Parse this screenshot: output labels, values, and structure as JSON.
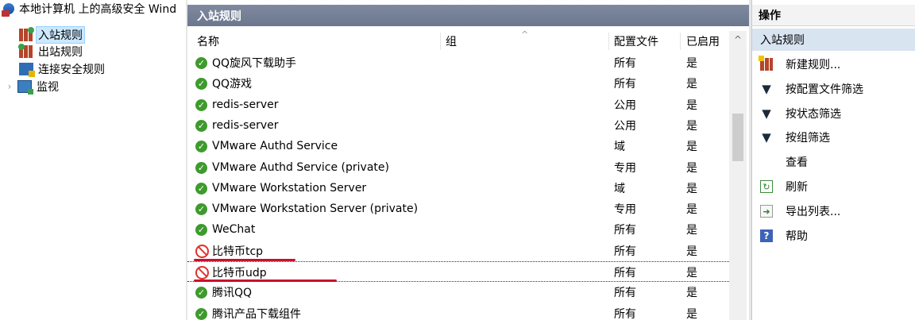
{
  "tree": {
    "root": "本地计算机 上的高级安全 Wind",
    "items": [
      {
        "label": "入站规则"
      },
      {
        "label": "出站规则"
      },
      {
        "label": "连接安全规则"
      },
      {
        "label": "监视"
      }
    ],
    "expander_glyph": "›"
  },
  "center": {
    "title": "入站规则",
    "columns": {
      "name": "名称",
      "group": "组",
      "profile": "配置文件",
      "enabled": "已启用"
    },
    "sort_caret": "^",
    "rules": [
      {
        "name": "QQ旋风下载助手",
        "profile": "所有",
        "enabled": "是",
        "status": "allow"
      },
      {
        "name": "QQ游戏",
        "profile": "所有",
        "enabled": "是",
        "status": "allow"
      },
      {
        "name": "redis-server",
        "profile": "公用",
        "enabled": "是",
        "status": "allow"
      },
      {
        "name": "redis-server",
        "profile": "公用",
        "enabled": "是",
        "status": "allow"
      },
      {
        "name": "VMware Authd Service",
        "profile": "域",
        "enabled": "是",
        "status": "allow"
      },
      {
        "name": "VMware Authd Service (private)",
        "profile": "专用",
        "enabled": "是",
        "status": "allow"
      },
      {
        "name": "VMware Workstation Server",
        "profile": "域",
        "enabled": "是",
        "status": "allow"
      },
      {
        "name": "VMware Workstation Server (private)",
        "profile": "专用",
        "enabled": "是",
        "status": "allow"
      },
      {
        "name": "WeChat",
        "profile": "所有",
        "enabled": "是",
        "status": "allow"
      },
      {
        "name": "比特币tcp",
        "profile": "所有",
        "enabled": "是",
        "status": "block"
      },
      {
        "name": "比特币udp",
        "profile": "所有",
        "enabled": "是",
        "status": "block"
      },
      {
        "name": "腾讯QQ",
        "profile": "所有",
        "enabled": "是",
        "status": "allow"
      },
      {
        "name": "腾讯产品下载组件",
        "profile": "所有",
        "enabled": "是",
        "status": "allow"
      }
    ],
    "scroll_up_glyph": "^"
  },
  "actions": {
    "title": "操作",
    "section": "入站规则",
    "items": [
      {
        "label": "新建规则...",
        "icon": "new-rule-icon"
      },
      {
        "label": "按配置文件筛选",
        "icon": "filter-icon"
      },
      {
        "label": "按状态筛选",
        "icon": "filter-icon"
      },
      {
        "label": "按组筛选",
        "icon": "filter-icon"
      },
      {
        "label": "查看",
        "icon": ""
      },
      {
        "label": "刷新",
        "icon": "refresh-icon"
      },
      {
        "label": "导出列表...",
        "icon": "export-icon"
      },
      {
        "label": "帮助",
        "icon": "help-icon"
      }
    ]
  },
  "colors": {
    "header_bg": "#6b778d",
    "selection": "#cce8ff",
    "action_section": "#d9e4f1",
    "allow_green": "#3f9a2d",
    "block_red": "#e0322c",
    "annotation_red": "#c8102e"
  }
}
